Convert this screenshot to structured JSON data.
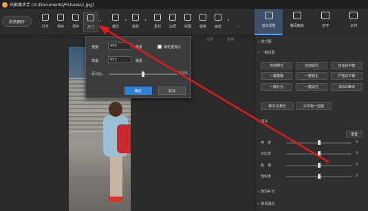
{
  "window": {
    "title": "光影魔术手 [D:\\Documents\\Pictures\\1.jpg]"
  },
  "toolbar": {
    "open_label": "浏览图片",
    "tools": [
      {
        "label": "打开",
        "icon": "open-icon"
      },
      {
        "label": "保存",
        "icon": "save-icon"
      },
      {
        "label": "另存",
        "icon": "save-as-icon"
      },
      {
        "label": "尺寸",
        "icon": "resize-icon"
      },
      {
        "label": "裁剪",
        "icon": "crop-icon"
      },
      {
        "label": "旋转",
        "icon": "rotate-icon"
      },
      {
        "label": "素材",
        "icon": "material-icon"
      },
      {
        "label": "边框",
        "icon": "border-icon"
      },
      {
        "label": "拼图",
        "icon": "collage-icon"
      },
      {
        "label": "模板",
        "icon": "template-icon"
      },
      {
        "label": "画笔",
        "icon": "brush-icon"
      },
      {
        "label": "...",
        "icon": "more-icon"
      }
    ]
  },
  "right_tabs": [
    {
      "label": "基本调整",
      "icon": "adjust-icon"
    },
    {
      "label": "数码暗房",
      "icon": "darkroom-icon"
    },
    {
      "label": "文字",
      "icon": "text-icon"
    },
    {
      "label": "水印",
      "icon": "watermark-icon"
    }
  ],
  "subbar": {
    "items": [
      "还原",
      "重做"
    ]
  },
  "resize_dialog": {
    "width_label": "宽度:",
    "width_value": "450",
    "width_unit": "像素",
    "height_label": "高度:",
    "height_value": "853",
    "height_unit": "像素",
    "lock_label": "锁定宽高比",
    "percent_label": "百分比:",
    "percent_value": "100%",
    "percent_level": 0.5,
    "ok_label": "确定",
    "cancel_label": "取消"
  },
  "panel": {
    "histogram_label": "直方图",
    "oneclick_label": "一键设置",
    "oneclick_buttons": [
      "自动曝光",
      "自动减光",
      "自动白平衡",
      "一键模糊",
      "一键锐化",
      "严重白平衡",
      "一键补光",
      "一键减光",
      "高ISO降噪"
    ],
    "extra_buttons": [
      "数字点测光",
      "白平衡一指键"
    ],
    "basic_label": "基本",
    "reset_label": "重置",
    "sliders": [
      {
        "label": "亮　度",
        "value": "0",
        "level": 0.5
      },
      {
        "label": "对比度",
        "value": "0",
        "level": 0.5
      },
      {
        "label": "色　相",
        "value": "0",
        "level": 0.5
      },
      {
        "label": "饱和度",
        "value": "0",
        "level": 0.5
      }
    ],
    "fill_light_label": "数码补光",
    "reduce_light_label": "数码减光"
  }
}
